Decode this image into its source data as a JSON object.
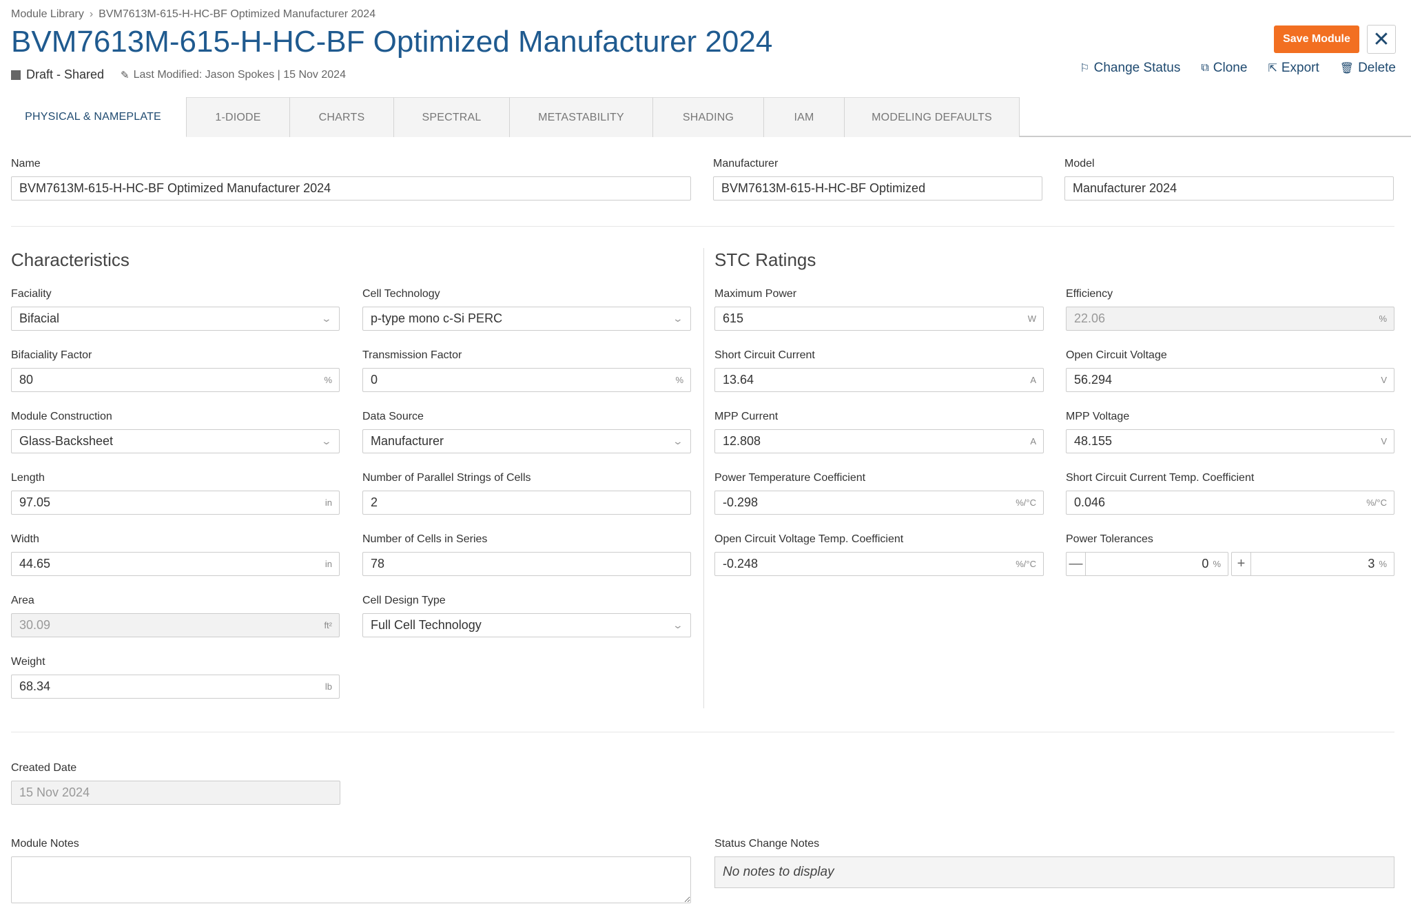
{
  "breadcrumb": {
    "root": "Module Library",
    "current": "BVM7613M-615-H-HC-BF Optimized Manufacturer 2024"
  },
  "title": "BVM7613M-615-H-HC-BF Optimized Manufacturer 2024",
  "status": {
    "label": "Draft - Shared",
    "last_modified": "Last Modified: Jason Spokes | 15 Nov 2024"
  },
  "buttons": {
    "save": "Save Module",
    "close": "✕"
  },
  "actions": {
    "change_status": "Change Status",
    "clone": "Clone",
    "export": "Export",
    "delete": "Delete"
  },
  "tabs": [
    "PHYSICAL & NAMEPLATE",
    "1-DIODE",
    "CHARTS",
    "SPECTRAL",
    "METASTABILITY",
    "SHADING",
    "IAM",
    "MODELING DEFAULTS"
  ],
  "identity": {
    "name": {
      "label": "Name",
      "value": "BVM7613M-615-H-HC-BF Optimized Manufacturer 2024"
    },
    "manufacturer": {
      "label": "Manufacturer",
      "value": "BVM7613M-615-H-HC-BF Optimized"
    },
    "model": {
      "label": "Model",
      "value": "Manufacturer 2024"
    }
  },
  "characteristics": {
    "title": "Characteristics",
    "faciality": {
      "label": "Faciality",
      "value": "Bifacial"
    },
    "cell_technology": {
      "label": "Cell Technology",
      "value": "p-type mono c-Si PERC"
    },
    "bifaciality_factor": {
      "label": "Bifaciality Factor",
      "value": "80",
      "unit": "%"
    },
    "transmission_factor": {
      "label": "Transmission Factor",
      "value": "0",
      "unit": "%"
    },
    "module_construction": {
      "label": "Module Construction",
      "value": "Glass-Backsheet"
    },
    "data_source": {
      "label": "Data Source",
      "value": "Manufacturer"
    },
    "length": {
      "label": "Length",
      "value": "97.05",
      "unit": "in"
    },
    "parallel_strings": {
      "label": "Number of Parallel Strings of Cells",
      "value": "2"
    },
    "width": {
      "label": "Width",
      "value": "44.65",
      "unit": "in"
    },
    "cells_in_series": {
      "label": "Number of Cells in Series",
      "value": "78"
    },
    "area": {
      "label": "Area",
      "value": "30.09",
      "unit": "ft²"
    },
    "cell_design_type": {
      "label": "Cell Design Type",
      "value": "Full Cell Technology"
    },
    "weight": {
      "label": "Weight",
      "value": "68.34",
      "unit": "lb"
    }
  },
  "stc": {
    "title": "STC Ratings",
    "max_power": {
      "label": "Maximum Power",
      "value": "615",
      "unit": "W"
    },
    "efficiency": {
      "label": "Efficiency",
      "value": "22.06",
      "unit": "%"
    },
    "isc": {
      "label": "Short Circuit Current",
      "value": "13.64",
      "unit": "A"
    },
    "voc": {
      "label": "Open Circuit Voltage",
      "value": "56.294",
      "unit": "V"
    },
    "impp": {
      "label": "MPP Current",
      "value": "12.808",
      "unit": "A"
    },
    "vmpp": {
      "label": "MPP Voltage",
      "value": "48.155",
      "unit": "V"
    },
    "power_temp_coeff": {
      "label": "Power Temperature Coefficient",
      "value": "-0.298",
      "unit": "%/°C"
    },
    "isc_temp_coeff": {
      "label": "Short Circuit Current Temp. Coefficient",
      "value": "0.046",
      "unit": "%/°C"
    },
    "voc_temp_coeff": {
      "label": "Open Circuit Voltage Temp. Coefficient",
      "value": "-0.248",
      "unit": "%/°C"
    },
    "power_tolerances": {
      "label": "Power Tolerances",
      "minus_sign": "—",
      "minus_value": "0",
      "plus_sign": "+",
      "plus_value": "3",
      "unit": "%"
    }
  },
  "created": {
    "label": "Created Date",
    "value": "15 Nov 2024"
  },
  "notes": {
    "module_label": "Module Notes",
    "status_label": "Status Change Notes",
    "status_value": "No notes to display"
  },
  "colors": {
    "accent": "#f26f21",
    "title": "#1f5a8f",
    "link": "#1f4a70"
  }
}
